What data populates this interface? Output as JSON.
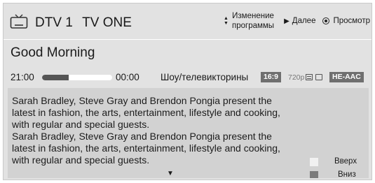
{
  "header": {
    "channel_name": "DTV 1",
    "channel_title": "TV ONE",
    "icon": "tv-icon",
    "change_program_label_line1": "Изменение",
    "change_program_label_line2": "программы",
    "next_label": "Далее",
    "view_label": "Просмотр"
  },
  "program": {
    "title": "Good Morning",
    "start_time": "21:00",
    "end_time": "00:00",
    "progress": 0.38,
    "genre": "Шоу/телевикторины",
    "aspect_badge": "16:9",
    "resolution": "720p",
    "audio_badge": "HE-AAC",
    "description_lines": [
      "Sarah Bradley, Steve Gray and Brendon Pongia present the",
      "latest in fashion, the arts, entertainment, lifestyle and cooking,",
      "with regular and special guests.",
      "Sarah Bradley, Steve Gray and Brendon Pongia present the",
      "latest in fashion, the arts, entertainment, lifestyle and cooking,",
      "with regular and special guests."
    ]
  },
  "legend": {
    "up_label": "Вверх",
    "down_label": "Вниз"
  },
  "colors": {
    "panel": "#e2e2e2",
    "description_bg": "#d2d2d2",
    "badge": "#6f6f6f"
  }
}
